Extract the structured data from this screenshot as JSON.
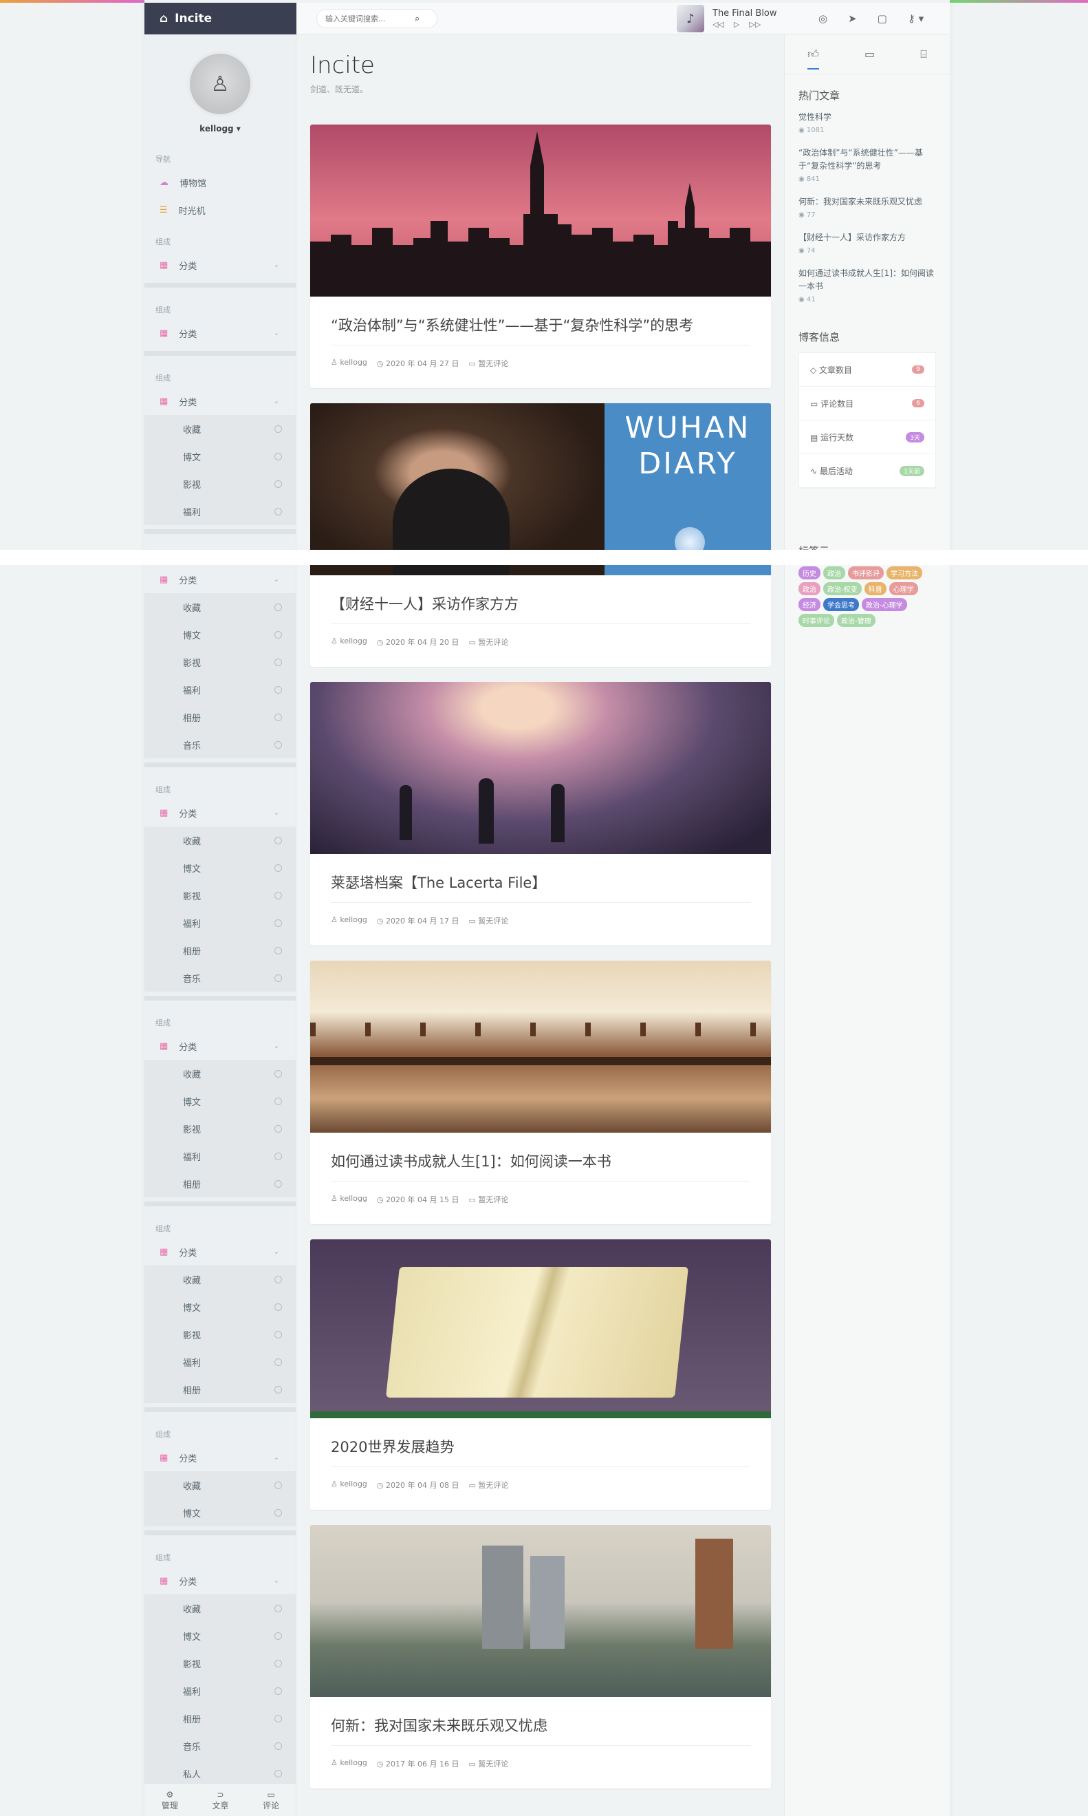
{
  "brand": {
    "name": "Incite"
  },
  "search": {
    "placeholder": "输入关键词搜索..."
  },
  "player": {
    "song": "The Final Blow"
  },
  "sidebar": {
    "user": "kellogg ▾",
    "nav_heading": "导航",
    "nav_items": [
      "博物馆",
      "时光机"
    ],
    "group_heading": "组成",
    "group_label": "分类",
    "groups": [
      [],
      [],
      [
        "收藏",
        "博文",
        "影视",
        "福利"
      ],
      [
        "收藏",
        "博文",
        "影视",
        "福利",
        "相册",
        "音乐"
      ],
      [
        "收藏",
        "博文",
        "影视",
        "福利",
        "相册",
        "音乐"
      ],
      [
        "收藏",
        "博文",
        "影视",
        "福利",
        "相册"
      ],
      [
        "收藏",
        "博文",
        "影视",
        "福利",
        "相册"
      ],
      [
        "收藏",
        "博文"
      ],
      [
        "收藏",
        "博文",
        "影视",
        "福利",
        "相册",
        "音乐",
        "私人"
      ]
    ],
    "bottom": [
      "管理",
      "文章",
      "评论"
    ]
  },
  "main": {
    "title": "Incite",
    "subtitle": "剑道、既无道。",
    "posts": [
      {
        "title": "“政治体制”与“系统健壮性”——基于“复杂性科学”的思考",
        "author": "kellogg",
        "date": "2020 年 04 月 27 日",
        "comments": "暂无评论"
      },
      {
        "title": "【财经十一人】采访作家方方",
        "author": "kellogg",
        "date": "2020 年 04 月 20 日",
        "comments": "暂无评论",
        "img_text": "WUHAN\nDIARY"
      },
      {
        "title": "莱瑟塔档案【The Lacerta File】",
        "author": "kellogg",
        "date": "2020 年 04 月 17 日",
        "comments": "暂无评论"
      },
      {
        "title": "如何通过读书成就人生[1]：如何阅读一本书",
        "author": "kellogg",
        "date": "2020 年 04 月 15 日",
        "comments": "暂无评论"
      },
      {
        "title": "2020世界发展趋势",
        "author": "kellogg",
        "date": "2020 年 04 月 08 日",
        "comments": "暂无评论"
      },
      {
        "title": "何新：我对国家未来既乐观又忧虑",
        "author": "kellogg",
        "date": "2017 年 06 月 16 日",
        "comments": "暂无评论"
      }
    ]
  },
  "right": {
    "hot_heading": "热门文章",
    "hot": [
      {
        "title": "觉性科学",
        "views": "1081"
      },
      {
        "title": "“政治体制”与“系统健壮性”——基于“复杂性科学”的思考",
        "views": "841"
      },
      {
        "title": "何新：我对国家未来既乐观又忧虑",
        "views": "77"
      },
      {
        "title": "【财经十一人】采访作家方方",
        "views": "74"
      },
      {
        "title": "如何通过读书成就人生[1]：如何阅读一本书",
        "views": "41"
      }
    ],
    "info_heading": "博客信息",
    "info": [
      {
        "label": "文章数目",
        "value": "9",
        "color": "#e89b9b"
      },
      {
        "label": "评论数目",
        "value": "6",
        "color": "#e89b9b"
      },
      {
        "label": "运行天数",
        "value": "3天",
        "color": "#c48be0"
      },
      {
        "label": "最后活动",
        "value": "1天前",
        "color": "#a8d8a8"
      }
    ],
    "tags_heading": "标签云",
    "tags": [
      {
        "t": "历史",
        "c": "#c48be0"
      },
      {
        "t": "政治",
        "c": "#a8d8a8"
      },
      {
        "t": "书评影评",
        "c": "#e89b9b"
      },
      {
        "t": "学习方法",
        "c": "#e8b46b"
      },
      {
        "t": "政治",
        "c": "#e8a0c0"
      },
      {
        "t": "政治-权变",
        "c": "#a8d8a8"
      },
      {
        "t": "科普",
        "c": "#e8b46b"
      },
      {
        "t": "心理学",
        "c": "#e89b9b"
      },
      {
        "t": "经济",
        "c": "#c48be0"
      },
      {
        "t": "学会思考",
        "c": "#3d78c9"
      },
      {
        "t": "政治-心理学",
        "c": "#c48be0"
      },
      {
        "t": "时事评论",
        "c": "#a8d8a8"
      },
      {
        "t": "政治-管理",
        "c": "#a8d8a8"
      }
    ]
  }
}
